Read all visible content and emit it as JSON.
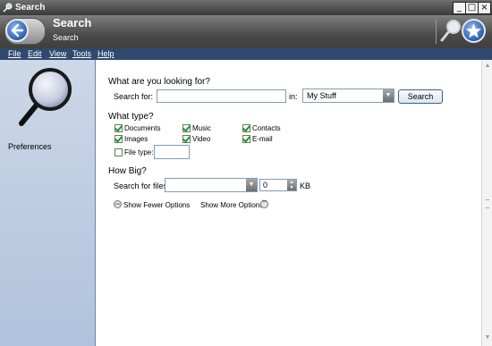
{
  "window": {
    "title": "Search"
  },
  "header": {
    "title": "Search",
    "subtitle": "Search"
  },
  "menu": [
    "File",
    "Edit",
    "View",
    "Tools",
    "Help"
  ],
  "sidebar": {
    "preferences_label": "Preferences"
  },
  "looking_for": {
    "heading": "What are you looking for?",
    "search_for_label": "Search for:",
    "search_value": "",
    "in_label": "in:",
    "location_value": "My Stuff",
    "search_button": "Search"
  },
  "type": {
    "heading": "What type?",
    "options": [
      {
        "label": "Documents",
        "checked": true
      },
      {
        "label": "Music",
        "checked": true
      },
      {
        "label": "Contacts",
        "checked": true
      },
      {
        "label": "Images",
        "checked": true
      },
      {
        "label": "Video",
        "checked": true
      },
      {
        "label": "E-mail",
        "checked": true
      }
    ],
    "file_type_label": "File type:",
    "file_type_checked": false,
    "file_type_value": ""
  },
  "size": {
    "heading": "How Big?",
    "search_files_label": "Search for files",
    "size_condition": "",
    "size_value": "0",
    "unit": "KB"
  },
  "options": {
    "fewer_label": "Show Fewer Options",
    "more_label": "Show More Options"
  }
}
